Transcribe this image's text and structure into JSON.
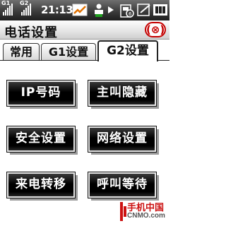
{
  "status_bar": {
    "sim1_tag": "G1",
    "sim2_tag": "G2",
    "time": "21:13",
    "icons": [
      "signal-icon",
      "signal-icon",
      "network-activity-icon",
      "person-icon",
      "play-icon",
      "keypad-lock-icon",
      "edit-icon",
      "battery-icon"
    ]
  },
  "title_bar": {
    "title": "电话设置",
    "close_label": "(⊗)"
  },
  "tabs": [
    {
      "label": "常用",
      "active": false
    },
    {
      "label": "G1设置",
      "active": false
    },
    {
      "label": "G2设置",
      "active": true
    }
  ],
  "options": [
    {
      "label": "IP号码",
      "focused": true
    },
    {
      "label": "主叫隐藏",
      "focused": false
    },
    {
      "label": "安全设置",
      "focused": false
    },
    {
      "label": "网络设置",
      "focused": false
    },
    {
      "label": "来电转移",
      "focused": false
    },
    {
      "label": "呼叫等待",
      "focused": false
    }
  ],
  "watermark": {
    "brand_cn": "手机中国",
    "brand_en": "CNMO.com"
  },
  "colors": {
    "accent_red": "#c40000",
    "button_bg": "#000000",
    "button_text": "#ffffff"
  }
}
